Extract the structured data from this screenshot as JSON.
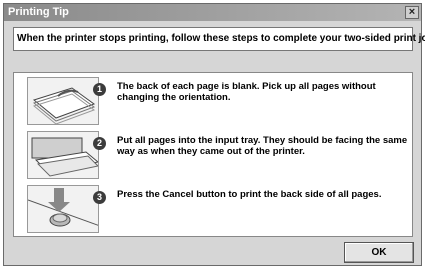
{
  "window": {
    "title": "Printing Tip",
    "close_glyph": "×"
  },
  "intro_text": "When the printer stops printing, follow these steps to complete your two-sided print job",
  "steps": [
    {
      "number": "1",
      "icon": "paper-stack-icon",
      "text": "The back of each page is blank. Pick up all pages without changing the orientation."
    },
    {
      "number": "2",
      "icon": "printer-input-tray-icon",
      "text": "Put all pages into the input tray. They should be facing the same way as when they came out of the printer."
    },
    {
      "number": "3",
      "icon": "cancel-button-press-icon",
      "text": "Press the Cancel button to print the back side of all pages."
    }
  ],
  "buttons": {
    "ok_label": "OK"
  }
}
